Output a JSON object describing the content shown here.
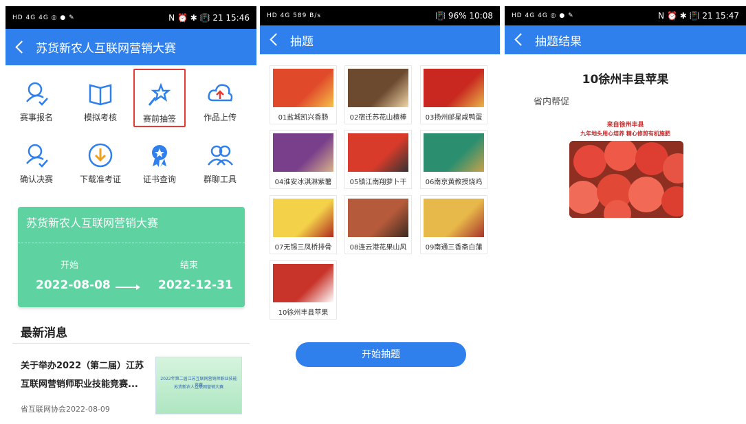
{
  "screen1": {
    "status_left": "HD 4G 4G ◎ ● ✎",
    "status_right": "N ⏰ ✱ 📳 21 15:46",
    "title": "苏货新农人互联网营销大赛",
    "grid": [
      {
        "label": "赛事报名",
        "icon": "user-check-icon"
      },
      {
        "label": "模拟考核",
        "icon": "book-icon"
      },
      {
        "label": "赛前抽签",
        "icon": "magic-wand-icon",
        "selected": true
      },
      {
        "label": "作品上传",
        "icon": "cloud-upload-icon"
      },
      {
        "label": "确认决赛",
        "icon": "user-confirm-icon"
      },
      {
        "label": "下载准考证",
        "icon": "download-icon"
      },
      {
        "label": "证书查询",
        "icon": "award-icon"
      },
      {
        "label": "群聊工具",
        "icon": "users-icon"
      }
    ],
    "banner": {
      "title": "苏货新农人互联网营销大赛",
      "start_label": "开始",
      "end_label": "结束",
      "start_date": "2022-08-08",
      "end_date": "2022-12-31"
    },
    "news": {
      "heading": "最新消息",
      "item_title": "关于举办2022（第二届）江苏互联网营销师职业技能竞赛...",
      "item_meta": "省互联网协会2022-08-09",
      "thumb_line1": "2022年第二届江苏互联网营销师职业技能竞赛",
      "thumb_line2": "苏货新农人互联网营销大赛"
    }
  },
  "screen2": {
    "status_left": "HD 4G 589 B/s",
    "status_right": "📳 96% 10:08",
    "title": "抽题",
    "products": [
      {
        "label": "01盐城凯兴香肠",
        "color": "#e04a2a",
        "accent": "#f6c04a"
      },
      {
        "label": "02宿迁苏花山楂棒",
        "color": "#6b4a2f",
        "accent": "#f0d6a8"
      },
      {
        "label": "03扬州邮星咸鸭蛋",
        "color": "#c8281f",
        "accent": "#e9b64a"
      },
      {
        "label": "04淮安冰淇淋紫薯",
        "color": "#7a3f8a",
        "accent": "#d8b38a"
      },
      {
        "label": "05镇江南翔萝卜干",
        "color": "#d83b2a",
        "accent": "#333333"
      },
      {
        "label": "06南京黄教授烧鸡",
        "color": "#2b8f6f",
        "accent": "#c9a24a"
      },
      {
        "label": "07无锡三凤桥排骨",
        "color": "#f3d24a",
        "accent": "#b02a1e"
      },
      {
        "label": "08连云港花果山风",
        "color": "#b55a3a",
        "accent": "#3a2a20"
      },
      {
        "label": "09南通三香斋白蒲",
        "color": "#e7b84a",
        "accent": "#a8342a"
      },
      {
        "label": "10徐州丰县苹果",
        "color": "#c8342a",
        "accent": "#ffffff"
      }
    ],
    "start_button": "开始抽题"
  },
  "screen3": {
    "status_left": "HD 4G 4G ◎ ● ✎",
    "status_right": "N ⏰ ✱ 📳 21 15:47",
    "title": "抽题结果",
    "result_title": "10徐州丰县苹果",
    "subtitle": "省内帮促",
    "caption1": "来自徐州丰县",
    "caption2": "九年地头用心培养 精心修剪有机施肥"
  },
  "colors": {
    "primary": "#2f80ed",
    "banner": "#5ed2a0",
    "selected_border": "#e53935"
  }
}
